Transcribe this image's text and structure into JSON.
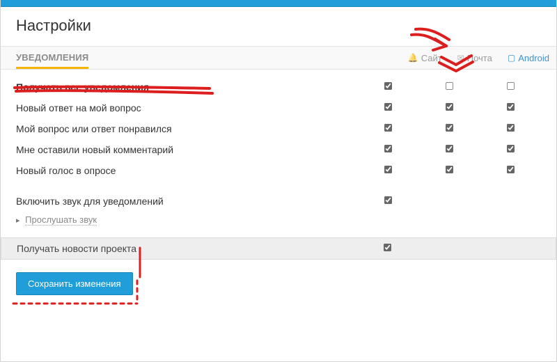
{
  "page_title": "Настройки",
  "tab_label": "УВЕДОМЛЕНИЯ",
  "channels": {
    "site_label": "Сайт",
    "mail_label": "Почта",
    "android_label": "Android"
  },
  "rows": {
    "all": {
      "label": "Получать все уведомления",
      "site": true,
      "mail": false,
      "android": false
    },
    "reply": {
      "label": "Новый ответ на мой вопрос",
      "site": true,
      "mail": true,
      "android": true
    },
    "liked": {
      "label": "Мой вопрос или ответ понравился",
      "site": true,
      "mail": true,
      "android": true
    },
    "comment": {
      "label": "Мне оставили новый комментарий",
      "site": true,
      "mail": true,
      "android": true
    },
    "vote": {
      "label": "Новый голос в опросе",
      "site": true,
      "mail": true,
      "android": true
    }
  },
  "sound": {
    "label": "Включить звук для уведомлений",
    "checked": true,
    "listen_label": "Прослушать звук"
  },
  "news": {
    "label": "Получать новости проекта",
    "checked": true
  },
  "save_button_label": "Сохранить изменения"
}
